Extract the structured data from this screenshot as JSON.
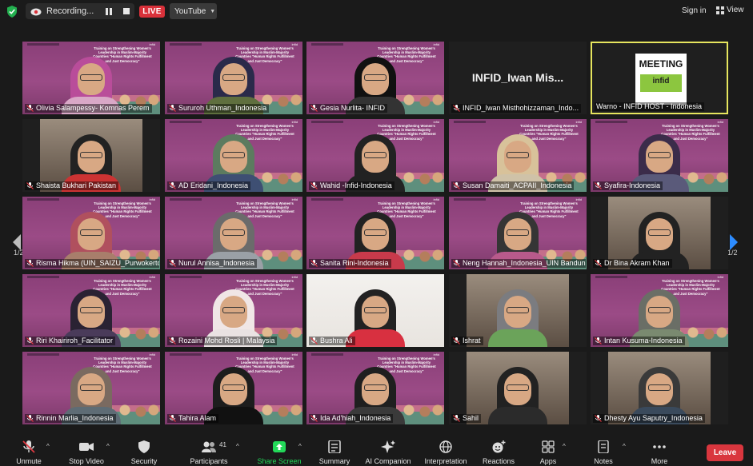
{
  "topbar": {
    "recording_label": "Recording...",
    "live_label": "LIVE",
    "stream_target": "YouTube",
    "sign_in_label": "Sign in",
    "view_label": "View"
  },
  "pagination": {
    "left": "1/2",
    "right": "1/2"
  },
  "slide_text": "Training on Strengthening Women's Leadership in Muslim-Majority Countries \"Human Rights Fulfillment and Just Democracy\"",
  "infid_logo_text": "infid",
  "meeting_logo_text": "MEETING",
  "participants": [
    {
      "name": "Olivia Salampessy- Komnas Perem",
      "muted": true
    },
    {
      "name": "Sururoh Uthman_Indonesia",
      "muted": true
    },
    {
      "name": "Gesia Nurlita- INFID",
      "muted": true
    },
    {
      "name": "INFID_Iwan Misthohizzaman_Indo...",
      "muted": true,
      "display_text": "INFID_Iwan  Mis..."
    },
    {
      "name": "Warno - INFID HOST - Indonesia",
      "muted": false
    },
    {
      "name": "Shaista Bukhari Pakistan",
      "muted": true
    },
    {
      "name": "AD Eridani_Indonesia",
      "muted": true
    },
    {
      "name": "Wahid -Infid-Indonesia",
      "muted": true
    },
    {
      "name": "Susan Damaiti_ACPAII_Indonesia",
      "muted": true
    },
    {
      "name": "Syafira-Indonesia",
      "muted": true
    },
    {
      "name": "Risma Hikma (UIN_SAIZU_Purwokerto)",
      "muted": true
    },
    {
      "name": "Nurul Annisa_Indonesia",
      "muted": true
    },
    {
      "name": "Sanita Rini-Indonesia",
      "muted": true
    },
    {
      "name": "Neng Hannah_Indonesia_UIN Bandung",
      "muted": true
    },
    {
      "name": "Dr Bina Akram Khan",
      "muted": true
    },
    {
      "name": "Riri Khairiroh_Facilitator",
      "muted": true
    },
    {
      "name": "Rozaini Mohd Rosli | Malaysia",
      "muted": true
    },
    {
      "name": "Bushra Ali",
      "muted": true
    },
    {
      "name": "Ishrat",
      "muted": true
    },
    {
      "name": "Intan Kusuma-Indonesia",
      "muted": true
    },
    {
      "name": "Rinnin Marlia_Indonesia",
      "muted": true
    },
    {
      "name": "Tahira Alam",
      "muted": true
    },
    {
      "name": "Ida Ad'hiah_Indonesia",
      "muted": true
    },
    {
      "name": "Sahil",
      "muted": true
    },
    {
      "name": "Dhesty Ayu Saputry_Indonesia",
      "muted": true
    }
  ],
  "toolbar": {
    "unmute": "Unmute",
    "stop_video": "Stop Video",
    "security": "Security",
    "participants": "Participants",
    "participants_count": "41",
    "share_screen": "Share Screen",
    "summary": "Summary",
    "ai_companion": "AI Companion",
    "interpretation": "Interpretation",
    "reactions": "Reactions",
    "apps": "Apps",
    "notes": "Notes",
    "more": "More",
    "leave": "Leave"
  },
  "colors": {
    "accent_green": "#23d959",
    "leave_red": "#d9363e",
    "live_red": "#d9313a",
    "host_border": "#e6e55e",
    "slide_purple": "#8a3f78"
  }
}
